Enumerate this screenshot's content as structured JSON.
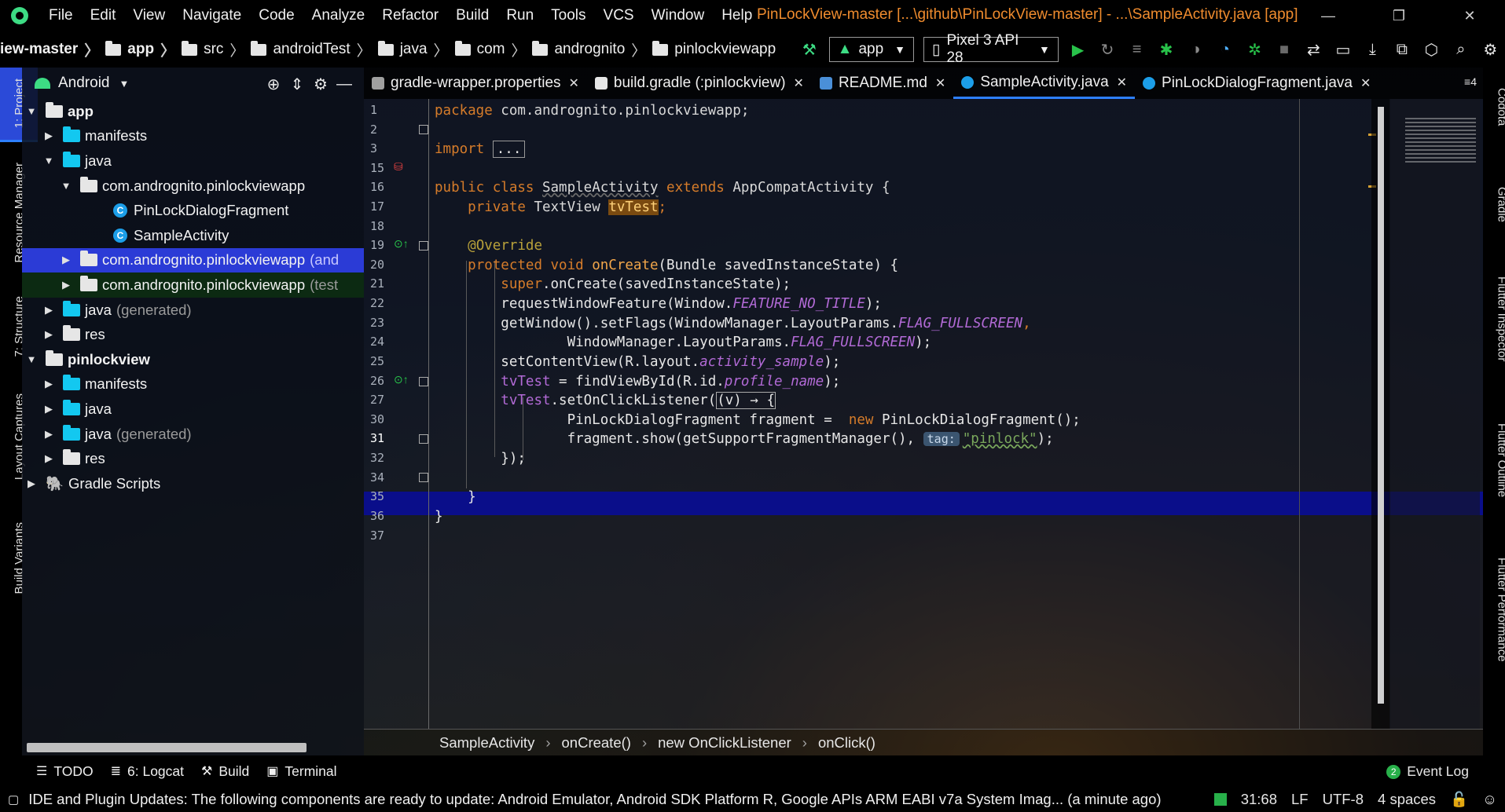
{
  "menubar": {
    "items": [
      {
        "label": "File"
      },
      {
        "label": "Edit"
      },
      {
        "label": "View"
      },
      {
        "label": "Navigate"
      },
      {
        "label": "Code"
      },
      {
        "label": "Analyze"
      },
      {
        "label": "Refactor"
      },
      {
        "label": "Build"
      },
      {
        "label": "Run"
      },
      {
        "label": "Tools"
      },
      {
        "label": "VCS"
      },
      {
        "label": "Window"
      },
      {
        "label": "Help"
      }
    ],
    "window_title": "PinLockView-master [...\\github\\PinLockView-master] - ...\\SampleActivity.java [app]",
    "title_color": "#f08c2e"
  },
  "navbar": {
    "breadcrumbs": [
      "iew-master",
      "app",
      "src",
      "androidTest",
      "java",
      "com",
      "andrognito",
      "pinlockviewapp"
    ],
    "run_config": "app",
    "device": "Pixel 3 API 28"
  },
  "left_strip": {
    "tabs": [
      "1: Project",
      "Resource Manager",
      "7: Structure",
      "Layout Captures",
      "Build Variants"
    ]
  },
  "right_strip": {
    "tabs": [
      "Codota",
      "Gradle",
      "Flutter Inspector",
      "Flutter Outline",
      "Flutter Performance"
    ]
  },
  "project": {
    "view": "Android",
    "tree": [
      {
        "label": "app",
        "bold": true
      },
      {
        "label": "manifests"
      },
      {
        "label": "java"
      },
      {
        "label": "com.andrognito.pinlockviewapp"
      },
      {
        "label": "PinLockDialogFragment"
      },
      {
        "label": "SampleActivity"
      },
      {
        "label": "com.andrognito.pinlockviewapp",
        "suffix": "(and"
      },
      {
        "label": "com.andrognito.pinlockviewapp",
        "suffix": "(test"
      },
      {
        "label": "java",
        "suffix": "(generated)"
      },
      {
        "label": "res"
      },
      {
        "label": "pinlockview",
        "bold": true
      },
      {
        "label": "manifests"
      },
      {
        "label": "java"
      },
      {
        "label": "java",
        "suffix": "(generated)"
      },
      {
        "label": "res"
      },
      {
        "label": "Gradle Scripts"
      }
    ]
  },
  "tabs": [
    {
      "label": "gradle-wrapper.properties"
    },
    {
      "label": "build.gradle (:pinlockview)"
    },
    {
      "label": "README.md"
    },
    {
      "label": "SampleActivity.java",
      "active": true
    },
    {
      "label": "PinLockDialogFragment.java"
    }
  ],
  "tabs_more": "≡4",
  "editor": {
    "line_numbers": [
      "1",
      "2",
      "3",
      "15",
      "16",
      "17",
      "18",
      "19",
      "20",
      "21",
      "22",
      "23",
      "24",
      "25",
      "26",
      "27",
      "30",
      "31",
      "32",
      "34",
      "35",
      "36",
      "37"
    ],
    "current_line": "31",
    "code": {
      "l1_kw": "package",
      "l1_rest": " com.andrognito.pinlockviewapp;",
      "l3_kw": "import",
      "l3_fold": "...",
      "l16_a": "public class",
      "l16_b": "SampleActivity",
      "l16_c": "extends",
      "l16_d": "AppCompatActivity {",
      "l17_a": "private",
      "l17_b": "TextView",
      "l17_c": "tvTest",
      "l17_d": ";",
      "l19": "@Override",
      "l20_a": "protected void",
      "l20_b": "onCreate",
      "l20_c": "(Bundle savedInstanceState) {",
      "l21_a": "super",
      "l21_b": ".onCreate(savedInstanceState);",
      "l22_a": "requestWindowFeature(Window.",
      "l22_b": "FEATURE_NO_TITLE",
      "l22_c": ");",
      "l23_a": "getWindow().setFlags(WindowManager.LayoutParams.",
      "l23_b": "FLAG_FULLSCREEN",
      "l23_c": ",",
      "l24_a": "WindowManager.LayoutParams.",
      "l24_b": "FLAG_FULLSCREEN",
      "l24_c": ");",
      "l25_a": "setContentView(R.layout.",
      "l25_b": "activity_sample",
      "l25_c": ");",
      "l26_a": "tvTest",
      "l26_b": " = findViewById(R.id.",
      "l26_c": "profile_name",
      "l26_d": ");",
      "l27_a": "tvTest",
      "l27_b": ".setOnClickListener(",
      "l27_c": "(v) → {",
      "l30_a": "PinLockDialogFragment fragment =  ",
      "l30_b": "new",
      "l30_c": " PinLockDialogFragment();",
      "l31_a": "fragment.show(getSupportFragmentManager(),",
      "l31_hint": "tag:",
      "l31_b": "\"pinlock\"",
      "l31_c": ");",
      "l32": "});",
      "l35": "}",
      "l36": "}"
    }
  },
  "editor_breadcrumb": [
    "SampleActivity",
    "onCreate()",
    "new OnClickListener",
    "onClick()"
  ],
  "bottom_tools": {
    "items": [
      "TODO",
      "6: Logcat",
      "Build",
      "Terminal"
    ],
    "event_log": "Event Log",
    "event_count": "2"
  },
  "statusbar": {
    "message": "IDE and Plugin Updates: The following components are ready to update: Android Emulator, Android SDK Platform R, Google APIs ARM EABI v7a System Imag... (a minute ago)",
    "position": "31:68",
    "line_sep": "LF",
    "encoding": "UTF-8",
    "indent": "4 spaces"
  }
}
